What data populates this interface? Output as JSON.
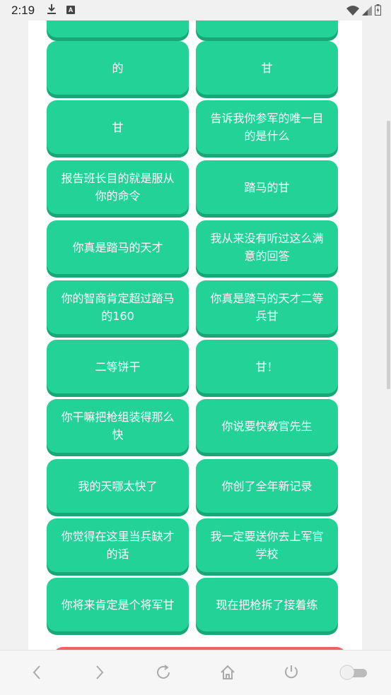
{
  "status_bar": {
    "time": "2:19",
    "icons": [
      "download-icon",
      "a-badge-icon",
      "wifi-icon",
      "signal-icon",
      "battery-icon"
    ],
    "badge_letter": "A"
  },
  "buttons": [
    {
      "label": ""
    },
    {
      "label": ""
    },
    {
      "label": "的"
    },
    {
      "label": "甘"
    },
    {
      "label": "甘"
    },
    {
      "label": "告诉我你参军的唯一目的是什么"
    },
    {
      "label": "报告班长目的就是服从你的命令"
    },
    {
      "label": "踏马的甘"
    },
    {
      "label": "你真是踏马的天才"
    },
    {
      "label": "我从来没有听过这么满意的回答"
    },
    {
      "label": "你的智商肯定超过踏马的160"
    },
    {
      "label": "你真是踏马的天才二等兵甘"
    },
    {
      "label": "二等饼干"
    },
    {
      "label": "甘！"
    },
    {
      "label": "你干嘛把枪组装得那么快"
    },
    {
      "label": "你说要快教官先生"
    },
    {
      "label": "我的天哪太快了"
    },
    {
      "label": "你创了全年新记录"
    },
    {
      "label": "你觉得在这里当兵缺才的话"
    },
    {
      "label": "我一定要送你去上军官学校"
    },
    {
      "label": "你将来肯定是个将军甘"
    },
    {
      "label": "现在把枪拆了接着练"
    }
  ],
  "colors": {
    "button_green": "#22d297",
    "button_shadow": "#1aa777",
    "red_button": "#ee6262"
  },
  "nav": {
    "icons": [
      "back-icon",
      "forward-icon",
      "reload-icon",
      "home-icon",
      "power-icon",
      "toggle-icon"
    ]
  }
}
